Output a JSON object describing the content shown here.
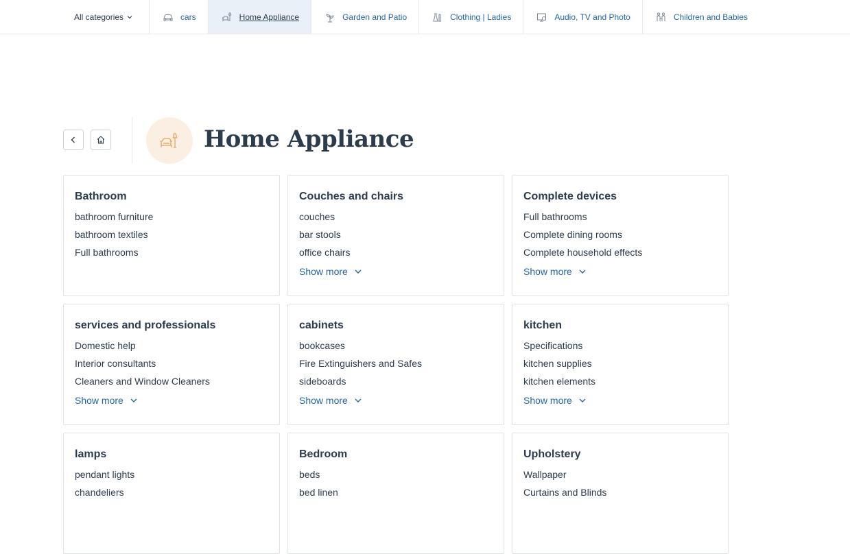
{
  "nav": {
    "all_categories": "All categories",
    "tabs": [
      {
        "label": "cars",
        "icon": "car-icon"
      },
      {
        "label": "Home Appliance",
        "icon": "armchair-lamp-icon",
        "active": true
      },
      {
        "label": "Garden and Patio",
        "icon": "plant-icon"
      },
      {
        "label": "Clothing | Ladies",
        "icon": "clothes-icon"
      },
      {
        "label": "Audio, TV and Photo",
        "icon": "tv-icon"
      },
      {
        "label": "Children and Babies",
        "icon": "family-icon"
      }
    ]
  },
  "header": {
    "title": "Home Appliance",
    "back_icon": "chevron-left-icon",
    "home_icon": "home-icon",
    "category_icon": "armchair-lamp-icon"
  },
  "show_more_label": "Show more",
  "categories": [
    {
      "title": "Bathroom",
      "items": [
        "bathroom furniture",
        "bathroom textiles",
        "Full bathrooms"
      ],
      "show_more": false
    },
    {
      "title": "Couches and chairs",
      "items": [
        "couches",
        "bar stools",
        "office chairs"
      ],
      "show_more": true
    },
    {
      "title": "Complete devices",
      "items": [
        "Full bathrooms",
        "Complete dining rooms",
        "Complete household effects"
      ],
      "show_more": true
    },
    {
      "title": "services and professionals",
      "items": [
        "Domestic help",
        "Interior consultants",
        "Cleaners and Window Cleaners"
      ],
      "show_more": true
    },
    {
      "title": "cabinets",
      "items": [
        "bookcases",
        "Fire Extinguishers and Safes",
        "sideboards"
      ],
      "show_more": true
    },
    {
      "title": "kitchen",
      "items": [
        "Specifications",
        "kitchen supplies",
        "kitchen elements"
      ],
      "show_more": true
    },
    {
      "title": "lamps",
      "items": [
        "pendant lights",
        "chandeliers",
        ""
      ],
      "show_more": false
    },
    {
      "title": "Bedroom",
      "items": [
        "beds",
        "bed linen",
        ""
      ],
      "show_more": false
    },
    {
      "title": "Upholstery",
      "items": [
        "Wallpaper",
        "Curtains and Blinds",
        ""
      ],
      "show_more": false
    }
  ],
  "colors": {
    "link": "#2466a8",
    "text": "#2d3c4d",
    "accent_icon": "#e8a35c",
    "active_tab_bg": "#eaf0f8"
  }
}
